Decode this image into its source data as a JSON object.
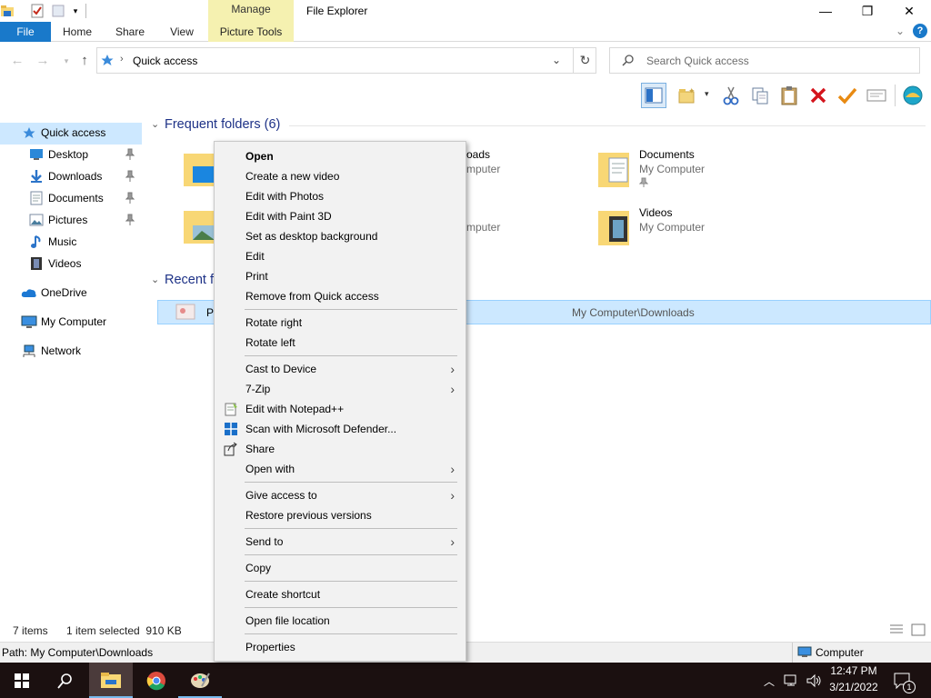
{
  "window": {
    "title": "File Explorer",
    "context_tab_group": "Manage",
    "controls": {
      "minimize": "—",
      "maximize": "❐",
      "close": "✕"
    }
  },
  "ribbon": {
    "tabs": [
      "File",
      "Home",
      "Share",
      "View",
      "Picture Tools"
    ],
    "help_label": "?"
  },
  "address": {
    "path": "Quick access",
    "search_placeholder": "Search Quick access"
  },
  "nav": {
    "quick_access": "Quick access",
    "pinned": [
      {
        "label": "Desktop",
        "icon": "desktop-icon"
      },
      {
        "label": "Downloads",
        "icon": "downloads-icon"
      },
      {
        "label": "Documents",
        "icon": "documents-icon"
      },
      {
        "label": "Pictures",
        "icon": "pictures-icon"
      },
      {
        "label": "Music",
        "icon": "music-icon"
      },
      {
        "label": "Videos",
        "icon": "videos-icon"
      }
    ],
    "onedrive": "OneDrive",
    "my_computer": "My Computer",
    "network": "Network"
  },
  "content": {
    "frequent_header": "Frequent folders (6)",
    "folders": [
      {
        "name": "oads",
        "location": "mputer"
      },
      {
        "name": "Documents",
        "location": "My Computer"
      },
      {
        "name": "mputer",
        "location": ""
      },
      {
        "name": "Videos",
        "location": "My Computer"
      }
    ],
    "recent_header": "Recent f",
    "recent_file_partial": "P",
    "recent_file_location": "My Computer\\Downloads"
  },
  "status": {
    "items": "7 items",
    "selected": "1 item selected  910 KB"
  },
  "details": {
    "path": "Path: My Computer\\Downloads",
    "zone": "Computer"
  },
  "taskbar": {
    "time": "12:47 PM",
    "date": "3/21/2022",
    "notification_count": "1"
  },
  "context_menu": {
    "items": [
      {
        "label": "Open",
        "bold": true
      },
      {
        "label": "Create a new video"
      },
      {
        "label": "Edit with Photos"
      },
      {
        "label": "Edit with Paint 3D"
      },
      {
        "label": "Set as desktop background"
      },
      {
        "label": "Edit"
      },
      {
        "label": "Print"
      },
      {
        "label": "Remove from Quick access"
      },
      {
        "label": "Rotate right"
      },
      {
        "label": "Rotate left"
      },
      {
        "label": "Cast to Device",
        "submenu": true
      },
      {
        "label": "7-Zip",
        "submenu": true
      },
      {
        "label": "Edit with Notepad++",
        "icon": "notepadpp-icon"
      },
      {
        "label": "Scan with Microsoft Defender...",
        "icon": "defender-icon"
      },
      {
        "label": "Share",
        "icon": "share-icon"
      },
      {
        "label": "Open with",
        "submenu": true
      },
      {
        "label": "Give access to",
        "submenu": true
      },
      {
        "label": "Restore previous versions"
      },
      {
        "label": "Send to",
        "submenu": true
      },
      {
        "label": "Copy"
      },
      {
        "label": "Create shortcut"
      },
      {
        "label": "Open file location"
      },
      {
        "label": "Properties"
      }
    ]
  },
  "colors": {
    "accent": "#1979ca",
    "selection": "#cce8ff",
    "group_header": "#1e3287",
    "manage_tab": "#f5f1b0",
    "taskbar": "#1b1010"
  }
}
